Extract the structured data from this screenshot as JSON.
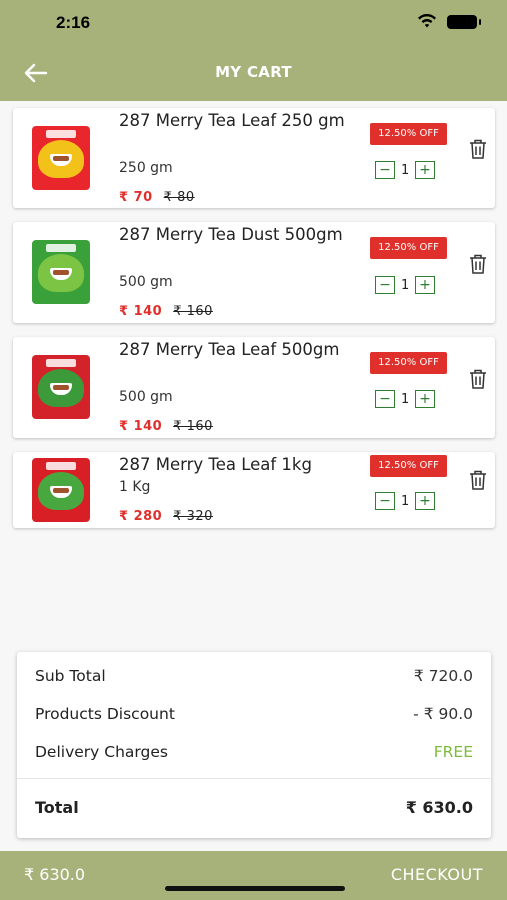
{
  "status_bar": {
    "time": "2:16"
  },
  "header": {
    "title": "MY CART"
  },
  "cart_items": [
    {
      "name": "287 Merry Tea Leaf 250 gm",
      "weight": "250 gm",
      "price": "₹ 70",
      "original_price": "₹ 80",
      "discount": "12.50% OFF",
      "quantity": "1",
      "pack_color": "#e8262b",
      "band_color": "#f2c21b"
    },
    {
      "name": "287 Merry Tea Dust 500gm",
      "weight": "500 gm",
      "price": "₹ 140",
      "original_price": "₹ 160",
      "discount": "12.50% OFF",
      "quantity": "1",
      "pack_color": "#3aa03a",
      "band_color": "#7cc443"
    },
    {
      "name": "287 Merry Tea Leaf 500gm",
      "weight": "500 gm",
      "price": "₹ 140",
      "original_price": "₹ 160",
      "discount": "12.50% OFF",
      "quantity": "1",
      "pack_color": "#d3222a",
      "band_color": "#3c9a3a"
    },
    {
      "name": "287 Merry Tea Leaf 1kg",
      "weight": "1 Kg",
      "price": "₹ 280",
      "original_price": "₹ 320",
      "discount": "12.50% OFF",
      "quantity": "1",
      "pack_color": "#d81f26",
      "band_color": "#48a83f"
    }
  ],
  "summary": {
    "sub_total_label": "Sub Total",
    "sub_total_value": "₹ 720.0",
    "discount_label": "Products Discount",
    "discount_value": "- ₹ 90.0",
    "delivery_label": "Delivery Charges",
    "delivery_value": "FREE",
    "total_label": "Total",
    "total_value": "₹ 630.0"
  },
  "bottom_bar": {
    "total": "₹ 630.0",
    "checkout_label": "CHECKOUT"
  },
  "colors": {
    "header": "#a6b27a",
    "discount_badge": "#e0302c",
    "price": "#e0302c",
    "free": "#7dbb3d",
    "qty_border": "#2e7d32"
  },
  "icons": [
    "wifi-icon",
    "battery-icon",
    "back-arrow-icon",
    "trash-icon",
    "minus-icon",
    "plus-icon"
  ]
}
